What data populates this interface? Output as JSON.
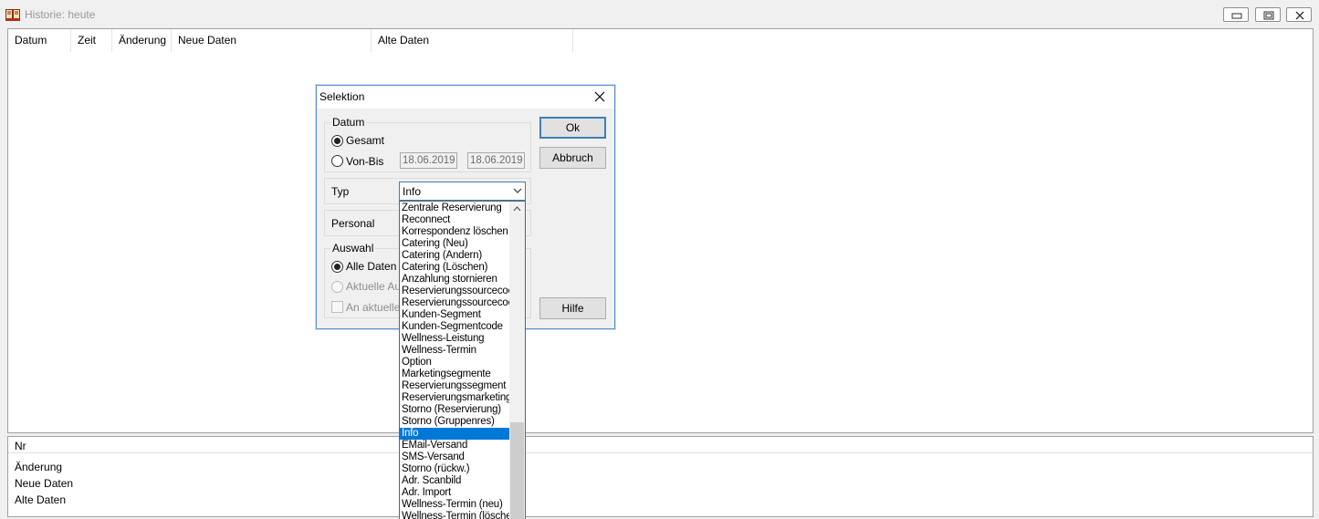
{
  "window": {
    "title": "Historie: heute",
    "icon": "book-icon"
  },
  "table": {
    "columns": [
      "Datum",
      "Zeit",
      "Änderung",
      "Neue Daten",
      "Alte Daten"
    ]
  },
  "details": {
    "labels": [
      "Nr",
      "Änderung",
      "Neue Daten",
      "Alte Daten"
    ]
  },
  "dialog": {
    "title": "Selektion",
    "datum_group": "Datum",
    "radio_gesamt": "Gesamt",
    "radio_vonbis": "Von-Bis",
    "date_from": "18.06.2019",
    "date_to": "18.06.2019",
    "typ_label": "Typ",
    "typ_value": "Info",
    "personal_label": "Personal",
    "auswahl_group": "Auswahl",
    "radio_alle": "Alle Daten",
    "radio_aktuelle": "Aktuelle Aus",
    "check_an_aktuelle": "An aktuelle A",
    "ok_button": "Ok",
    "abbruch_button": "Abbruch",
    "hilfe_button": "Hilfe"
  },
  "dropdown": {
    "selected": "Info",
    "items": [
      "Zentrale Reservierung",
      "Reconnect",
      "Korrespondenz löschen",
      "Catering (Neu)",
      "Catering (Ändern)",
      "Catering (Löschen)",
      "Anzahlung stornieren",
      "Reservierungssourcecoc",
      "Reservierungssourcecoc",
      "Kunden-Segment",
      "Kunden-Segmentcode",
      "Wellness-Leistung",
      "Wellness-Termin",
      "Option",
      "Marketingsegmente",
      "Reservierungssegment",
      "Reservierungsmarketingc",
      "Storno (Reservierung)",
      "Storno (Gruppenres)",
      "Info",
      "EMail-Versand",
      "SMS-Versand",
      "Storno (rückw.)",
      "Adr. Scanbild",
      "Adr. Import",
      "Wellness-Termin (neu)",
      "Wellness-Termin (löschen"
    ]
  }
}
